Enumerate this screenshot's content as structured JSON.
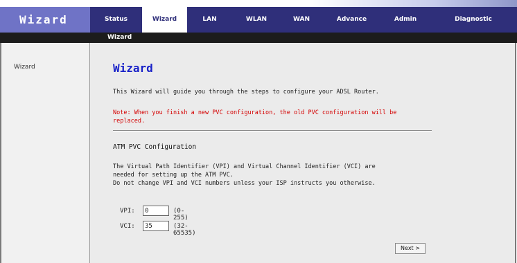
{
  "header": {
    "logo": "Wizard",
    "nav": [
      {
        "label": "Status"
      },
      {
        "label": "Wizard",
        "active": true
      },
      {
        "label": "LAN"
      },
      {
        "label": "WLAN"
      },
      {
        "label": "WAN"
      },
      {
        "label": "Advance"
      },
      {
        "label": "Admin"
      },
      {
        "label": "Diagnostic"
      }
    ],
    "sub_item": "Wizard"
  },
  "sidebar": {
    "item": "Wizard"
  },
  "main": {
    "title": "Wizard",
    "description": "This Wizard will guide you through the steps to configure your ADSL Router.",
    "warning": "Note: When you finish a new PVC configuration, the old PVC configuration will be replaced.",
    "section_title": "ATM PVC Configuration",
    "info_line1": "The Virtual Path Identifier (VPI) and Virtual Channel Identifier (VCI) are",
    "info_line2": "needed for setting up the ATM PVC.",
    "info_line3": "Do not change VPI and VCI numbers unless your ISP instructs you otherwise.",
    "vpi": {
      "label": "VPI:",
      "value": "0",
      "range": "(0-255)"
    },
    "vci": {
      "label": "VCI:",
      "value": "35",
      "range": "(32-65535)"
    },
    "next_label": "Next >"
  }
}
